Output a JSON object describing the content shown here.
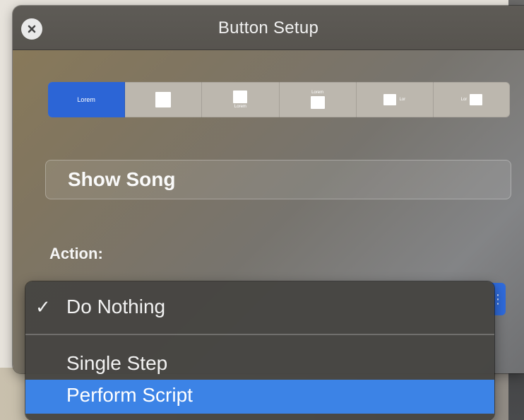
{
  "window": {
    "title": "Button Setup"
  },
  "segments": [
    {
      "label": "Lorem",
      "selected": true
    },
    {
      "label": "",
      "icon": "image-only-icon"
    },
    {
      "label": "Lorem",
      "icon": "image-above-icon"
    },
    {
      "label": "Lorem",
      "icon": "image-below-icon"
    },
    {
      "label": "Lor",
      "icon": "image-left-icon"
    },
    {
      "label": "Lor",
      "icon": "image-right-icon"
    }
  ],
  "button_name_field": {
    "value": "Show Song"
  },
  "action": {
    "label": "Action:",
    "menu": {
      "items": [
        {
          "label": "Do Nothing",
          "checked": true
        },
        {
          "label": "Single Step"
        },
        {
          "label": "Perform Script",
          "highlighted": true
        }
      ]
    }
  },
  "colors": {
    "accent": "#2c65d6",
    "menu_highlight": "#3c83e6"
  }
}
